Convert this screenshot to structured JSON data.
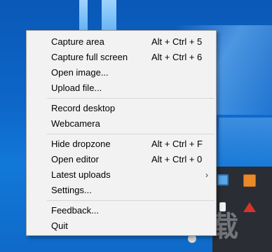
{
  "menu": {
    "sections": [
      [
        {
          "label": "Capture area",
          "shortcut": "Alt + Ctrl + 5"
        },
        {
          "label": "Capture full screen",
          "shortcut": "Alt + Ctrl + 6"
        },
        {
          "label": "Open image...",
          "shortcut": ""
        },
        {
          "label": "Upload file...",
          "shortcut": ""
        }
      ],
      [
        {
          "label": "Record desktop",
          "shortcut": ""
        },
        {
          "label": "Webcamera",
          "shortcut": ""
        }
      ],
      [
        {
          "label": "Hide dropzone",
          "shortcut": "Alt + Ctrl + F"
        },
        {
          "label": "Open editor",
          "shortcut": "Alt + Ctrl + 0"
        },
        {
          "label": "Latest uploads",
          "shortcut": "",
          "submenu_arrow": "›"
        },
        {
          "label": "Settings...",
          "shortcut": ""
        }
      ],
      [
        {
          "label": "Feedback...",
          "shortcut": ""
        },
        {
          "label": "Quit",
          "shortcut": ""
        }
      ]
    ]
  },
  "colors": {
    "wallpaper": "#0d67c9",
    "menu_background": "#f2f2f2",
    "menu_border": "#a0a0a0",
    "separator": "#d6d6d6",
    "taskbar": "#2a2d33"
  },
  "icons": [
    "windows-wallpaper-light-beam",
    "tray-app-icon",
    "tray-folder-icon",
    "tray-alert-icon",
    "tray-document-icon",
    "tray-network-icon"
  ]
}
